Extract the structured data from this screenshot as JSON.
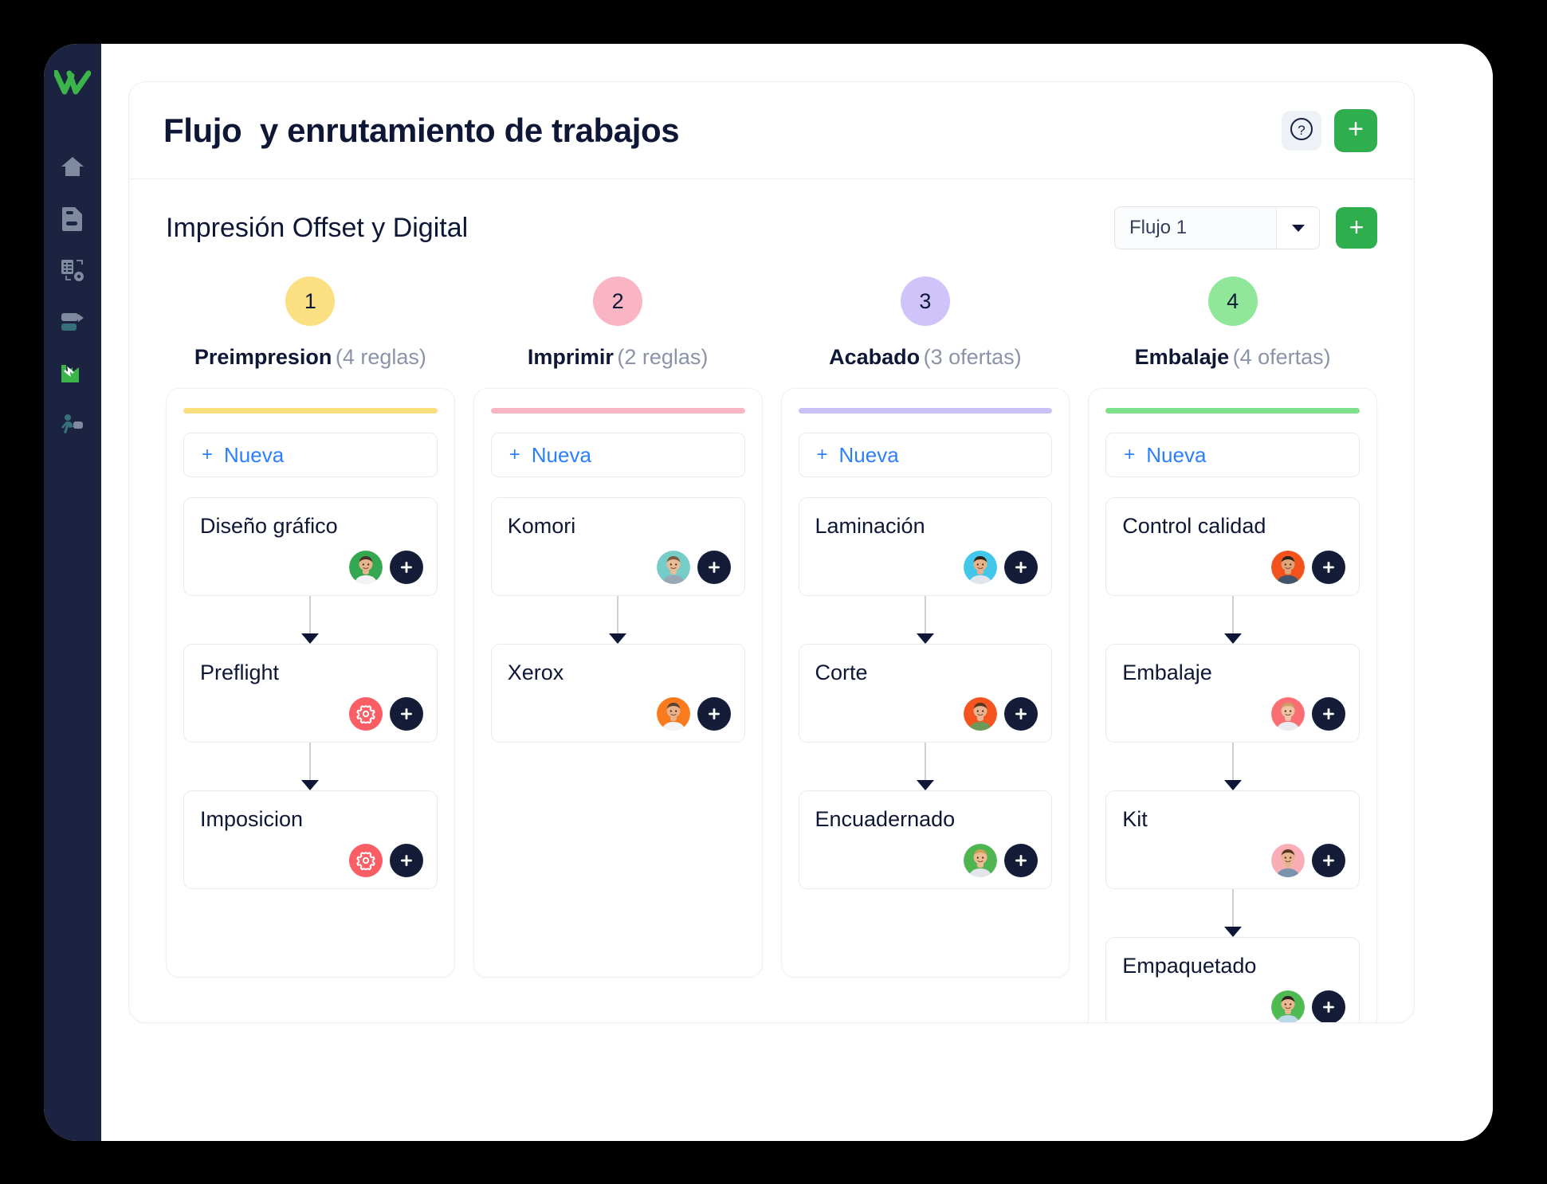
{
  "sidebar": {
    "logo_name": "brand-logo",
    "items": [
      {
        "name": "home",
        "icon": "home-icon"
      },
      {
        "name": "documents",
        "icon": "document-icon"
      },
      {
        "name": "job-settings",
        "icon": "list-settings-icon"
      },
      {
        "name": "shipping",
        "icon": "delivery-icon"
      },
      {
        "name": "production",
        "icon": "factory-icon"
      },
      {
        "name": "operators",
        "icon": "worker-icon"
      }
    ]
  },
  "header": {
    "title": "Flujo  y enrutamiento de trabajos",
    "help_label": "?",
    "add_label": "+"
  },
  "subheader": {
    "subtitle": "Impresión Offset y Digital",
    "flow_select_value": "Flujo 1",
    "flow_select_caret": "▼",
    "add_label": "+"
  },
  "board": {
    "new_plus": "+",
    "new_label": "Nueva",
    "node_add_label": "+",
    "columns": [
      {
        "step": "1",
        "title": "Preimpresion",
        "count": "(4 reglas)",
        "badge_color": "#fae083",
        "accent_color": "#fadf7f",
        "nodes": [
          {
            "title": "Diseño gráfico",
            "badge": "avatar",
            "avatar_bg": "#35a750",
            "avatar_skin": "#e8b48d",
            "avatar_hair": "#4a3328",
            "avatar_shirt": "#f2f4f6"
          },
          {
            "title": "Preflight",
            "badge": "gear"
          },
          {
            "title": "Imposicion",
            "badge": "gear"
          }
        ]
      },
      {
        "step": "2",
        "title": "Imprimir",
        "count": "(2 reglas)",
        "badge_color": "#fab5c4",
        "accent_color": "#f9b6c2",
        "nodes": [
          {
            "title": "Komori",
            "badge": "avatar",
            "avatar_bg": "#76ccc6",
            "avatar_skin": "#e9bb96",
            "avatar_hair": "#7d5a3c",
            "avatar_shirt": "#9aa7b5"
          },
          {
            "title": "Xerox",
            "badge": "avatar",
            "avatar_bg": "#fa7a1e",
            "avatar_skin": "#eab28c",
            "avatar_hair": "#5b4330",
            "avatar_shirt": "#f3f4f6"
          }
        ]
      },
      {
        "step": "3",
        "title": "Acabado",
        "count": "(3 ofertas)",
        "badge_color": "#cfc3fa",
        "accent_color": "#ccc1f7",
        "nodes": [
          {
            "title": "Laminación",
            "badge": "avatar",
            "avatar_bg": "#42c6ea",
            "avatar_skin": "#e8b188",
            "avatar_hair": "#2d2118",
            "avatar_shirt": "#dfe5ea"
          },
          {
            "title": "Corte",
            "badge": "avatar",
            "avatar_bg": "#f4541f",
            "avatar_skin": "#e9b490",
            "avatar_hair": "#57341d",
            "avatar_shirt": "#6d9a5a"
          },
          {
            "title": "Encuadernado",
            "badge": "avatar",
            "avatar_bg": "#4eb551",
            "avatar_skin": "#eebb93",
            "avatar_hair": "#c9a05c",
            "avatar_shirt": "#e2e6ea"
          }
        ]
      },
      {
        "step": "4",
        "title": "Embalaje",
        "count": "(4 ofertas)",
        "badge_color": "#90e79a",
        "accent_color": "#7fe08c",
        "nodes": [
          {
            "title": "Control calidad",
            "badge": "avatar",
            "avatar_bg": "#f4521c",
            "avatar_skin": "#e0a277",
            "avatar_hair": "#29231e",
            "avatar_shirt": "#43556b"
          },
          {
            "title": "Embalaje",
            "badge": "avatar",
            "avatar_bg": "#fa6f74",
            "avatar_skin": "#f0c4a4",
            "avatar_hair": "#caa36a",
            "avatar_shirt": "#e8edf1"
          },
          {
            "title": "Kit",
            "badge": "avatar",
            "avatar_bg": "#f9aeb5",
            "avatar_skin": "#e7b48f",
            "avatar_hair": "#56361f",
            "avatar_shirt": "#7b93ae"
          },
          {
            "title": "Empaquetado",
            "badge": "avatar",
            "avatar_bg": "#4fba52",
            "avatar_skin": "#eab78f",
            "avatar_hair": "#2e2219",
            "avatar_shirt": "#bcd9e8"
          }
        ]
      }
    ]
  },
  "colors": {
    "sidebar_bg": "#1b2341",
    "brand_green": "#2fae4e",
    "link_blue": "#2b7fff",
    "text_dark": "#0e1736",
    "text_muted": "#8a93a8",
    "gear_red": "#fa5d63",
    "node_add_dark": "#141c38"
  }
}
